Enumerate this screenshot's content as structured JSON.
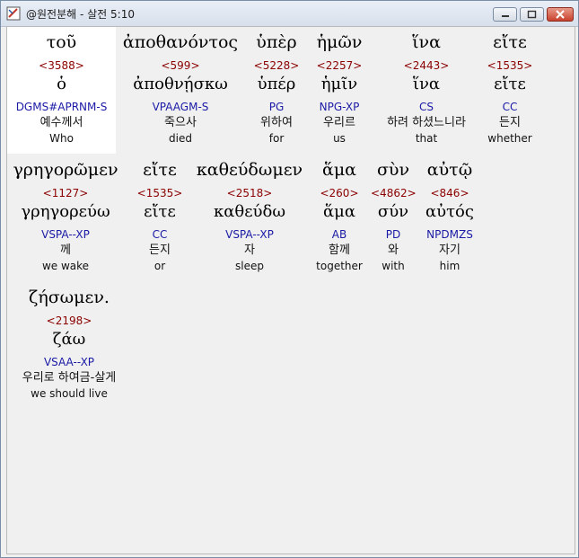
{
  "window": {
    "title": "@원전분해 - 살전 5:10",
    "min_icon": "minimize-icon",
    "max_icon": "maximize-icon",
    "close_icon": "close-icon"
  },
  "words": [
    {
      "greek": "τοῦ",
      "strong": "<3588>",
      "lemma": "ὁ",
      "morph": "DGMS#APRNM-S",
      "korean": "예수께서",
      "english": "Who"
    },
    {
      "greek": "ἀποθανόντος",
      "strong": "<599>",
      "lemma": "ἀποθνῄσκω",
      "morph": "VPAAGM-S",
      "korean": "죽으사",
      "english": "died"
    },
    {
      "greek": "ὑπὲρ",
      "strong": "<5228>",
      "lemma": "ὑπέρ",
      "morph": "PG",
      "korean": "위하여",
      "english": "for"
    },
    {
      "greek": "ἡμῶν",
      "strong": "<2257>",
      "lemma": "ἡμῖν",
      "morph": "NPG-XP",
      "korean": "우리르",
      "english": "us"
    },
    {
      "greek": "ἵνα",
      "strong": "<2443>",
      "lemma": "ἵνα",
      "morph": "CS",
      "korean": "하려 하셨느니라",
      "english": "that"
    },
    {
      "greek": "εἴτε",
      "strong": "<1535>",
      "lemma": "εἴτε",
      "morph": "CC",
      "korean": "든지",
      "english": "whether"
    },
    {
      "greek": "γρηγορῶμεν",
      "strong": "<1127>",
      "lemma": "γρηγορεύω",
      "morph": "VSPA--XP",
      "korean": "께",
      "english": "we wake"
    },
    {
      "greek": "εἴτε",
      "strong": "<1535>",
      "lemma": "εἴτε",
      "morph": "CC",
      "korean": "든지",
      "english": "or"
    },
    {
      "greek": "καθεύδωμεν",
      "strong": "<2518>",
      "lemma": "καθεύδω",
      "morph": "VSPA--XP",
      "korean": "자",
      "english": "sleep"
    },
    {
      "greek": "ἅμα",
      "strong": "<260>",
      "lemma": "ἅμα",
      "morph": "AB",
      "korean": "함께",
      "english": "together"
    },
    {
      "greek": "σὺν",
      "strong": "<4862>",
      "lemma": "σύν",
      "morph": "PD",
      "korean": "와",
      "english": "with"
    },
    {
      "greek": "αὐτῷ",
      "strong": "<846>",
      "lemma": "αὐτός",
      "morph": "NPDMZS",
      "korean": "자기",
      "english": "him"
    },
    {
      "greek": "ζήσωμεν.",
      "strong": "<2198>",
      "lemma": "ζάω",
      "morph": "VSAA--XP",
      "korean": "우리로 하여금-살게",
      "english": "we should live"
    }
  ]
}
